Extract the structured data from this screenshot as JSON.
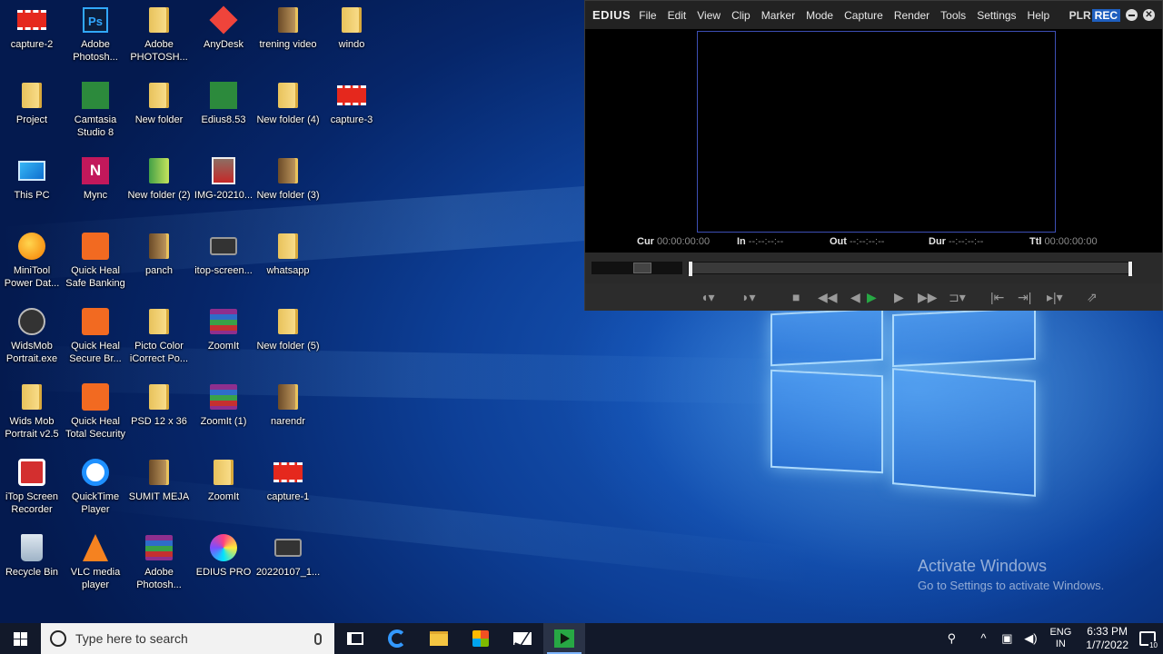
{
  "desktop": {
    "icons": [
      {
        "label": "capture-2",
        "type": "redclip"
      },
      {
        "label": "Adobe Photosh...",
        "type": "ps"
      },
      {
        "label": "Adobe PHOTOSH...",
        "type": "folder"
      },
      {
        "label": "AnyDesk",
        "type": "anydesk"
      },
      {
        "label": "trening video",
        "type": "folder-dark"
      },
      {
        "label": "windo",
        "type": "folder"
      },
      {
        "label": "Project",
        "type": "folder"
      },
      {
        "label": "Camtasia Studio 8",
        "type": "cam"
      },
      {
        "label": "New folder",
        "type": "folder"
      },
      {
        "label": "Edius8.53",
        "type": "cam"
      },
      {
        "label": "New folder (4)",
        "type": "folder"
      },
      {
        "label": "capture-3",
        "type": "redclip"
      },
      {
        "label": "This PC",
        "type": "pc"
      },
      {
        "label": "Mync",
        "type": "mync"
      },
      {
        "label": "New folder (2)",
        "type": "greenfolder"
      },
      {
        "label": "IMG-20210...",
        "type": "photo"
      },
      {
        "label": "New folder (3)",
        "type": "folder-dark"
      },
      {
        "label": "MiniTool Power Dat...",
        "type": "minitool"
      },
      {
        "label": "Quick Heal Safe Banking",
        "type": "qh"
      },
      {
        "label": "panch",
        "type": "folder-dark"
      },
      {
        "label": "itop-screen...",
        "type": "camera"
      },
      {
        "label": "whatsapp",
        "type": "folder"
      },
      {
        "label": "WidsMob Portrait.exe",
        "type": "widsmob"
      },
      {
        "label": "Quick Heal Secure Br...",
        "type": "qh"
      },
      {
        "label": "Picto Color iCorrect Po...",
        "type": "folder"
      },
      {
        "label": "ZoomIt",
        "type": "winrar"
      },
      {
        "label": "New folder (5)",
        "type": "folder"
      },
      {
        "label": "Wids Mob Portrait v2.5",
        "type": "folder"
      },
      {
        "label": "Quick Heal Total Security",
        "type": "qh"
      },
      {
        "label": "PSD 12 x 36",
        "type": "folder"
      },
      {
        "label": "ZoomIt (1)",
        "type": "winrar"
      },
      {
        "label": "narendr",
        "type": "folder-dark"
      },
      {
        "label": "iTop Screen Recorder",
        "type": "itop"
      },
      {
        "label": "QuickTime Player",
        "type": "quicktime"
      },
      {
        "label": "SUMIT MEJA",
        "type": "folder-dark"
      },
      {
        "label": "ZoomIt",
        "type": "folder"
      },
      {
        "label": "capture-1",
        "type": "redclip"
      },
      {
        "label": "Recycle Bin",
        "type": "recycle"
      },
      {
        "label": "VLC media player",
        "type": "vlc"
      },
      {
        "label": "Adobe Photosh...",
        "type": "winrar"
      },
      {
        "label": "EDIUS PRO",
        "type": "edius-pro"
      },
      {
        "label": "20220107_1...",
        "type": "camera"
      }
    ]
  },
  "edius": {
    "logo": "EDIUS",
    "menu": [
      "File",
      "Edit",
      "View",
      "Clip",
      "Marker",
      "Mode",
      "Capture",
      "Render",
      "Tools",
      "Settings",
      "Help"
    ],
    "plr": "PLR",
    "rec": "REC",
    "close_glyph": "✕",
    "timecodes": {
      "cur_label": "Cur",
      "cur_value": "00:00:00:00",
      "in_label": "In",
      "in_value": "--:--:--:--",
      "out_label": "Out",
      "out_value": "--:--:--:--",
      "dur_label": "Dur",
      "dur_value": "--:--:--:--",
      "ttl_label": "Ttl",
      "ttl_value": "00:00:00:00"
    }
  },
  "watermark": {
    "title": "Activate Windows",
    "subtitle": "Go to Settings to activate Windows."
  },
  "taskbar": {
    "search_placeholder": "Type here to search",
    "lang_top": "ENG",
    "lang_bottom": "IN",
    "time": "6:33 PM",
    "date": "1/7/2022",
    "notif_count": "10"
  }
}
